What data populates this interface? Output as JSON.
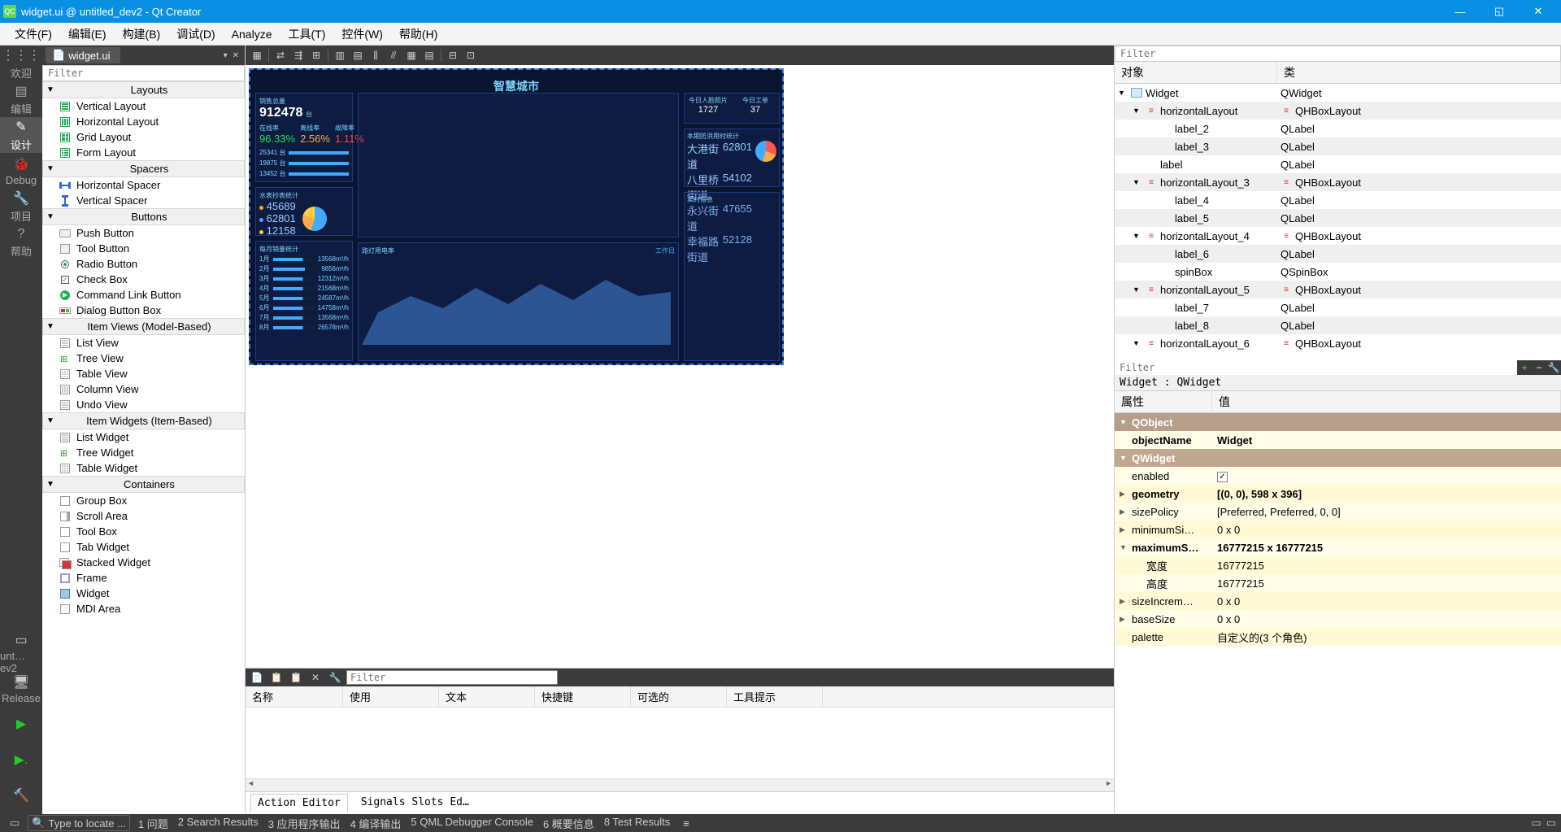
{
  "titlebar": {
    "icon_text": "QC",
    "text": "widget.ui @ untitled_dev2 - Qt Creator"
  },
  "menubar": [
    "文件(F)",
    "编辑(E)",
    "构建(B)",
    "调试(D)",
    "Analyze",
    "工具(T)",
    "控件(W)",
    "帮助(H)"
  ],
  "leftbar": [
    {
      "label": "欢迎",
      "icon": "⋮⋮⋮"
    },
    {
      "label": "编辑",
      "icon": "▤"
    },
    {
      "label": "设计",
      "icon": "✎",
      "active": true
    },
    {
      "label": "Debug",
      "icon": "🐞"
    },
    {
      "label": "项目",
      "icon": "🔧"
    },
    {
      "label": "帮助",
      "icon": "?"
    }
  ],
  "leftbar_bottom": [
    {
      "label": "unt…ev2",
      "icon": "▭"
    },
    {
      "label": "Release",
      "icon": "🖥"
    },
    {
      "label": "",
      "icon": "▶",
      "color": "#2c2"
    },
    {
      "label": "",
      "icon": "▶.",
      "color": "#2c2"
    },
    {
      "label": "",
      "icon": "🔨",
      "color": "#c84"
    }
  ],
  "tab_chip": {
    "icon": "📄",
    "label": "widget.ui"
  },
  "filter_placeholder": "Filter",
  "widgetbox": [
    {
      "cat": "Layouts",
      "items": [
        {
          "icon": "vlayout",
          "label": "Vertical Layout"
        },
        {
          "icon": "hlayout",
          "label": "Horizontal Layout"
        },
        {
          "icon": "grid",
          "label": "Grid Layout"
        },
        {
          "icon": "form",
          "label": "Form Layout"
        }
      ]
    },
    {
      "cat": "Spacers",
      "items": [
        {
          "icon": "hspacer",
          "label": "Horizontal Spacer"
        },
        {
          "icon": "vspacer",
          "label": "Vertical Spacer"
        }
      ]
    },
    {
      "cat": "Buttons",
      "items": [
        {
          "icon": "btn",
          "label": "Push Button"
        },
        {
          "icon": "tool",
          "label": "Tool Button"
        },
        {
          "icon": "radio",
          "label": "Radio Button"
        },
        {
          "icon": "check",
          "label": "Check Box"
        },
        {
          "icon": "cmdlink",
          "label": "Command Link Button"
        },
        {
          "icon": "dlgbox",
          "label": "Dialog Button Box"
        }
      ]
    },
    {
      "cat": "Item Views (Model-Based)",
      "items": [
        {
          "icon": "list",
          "label": "List View"
        },
        {
          "icon": "tree",
          "label": "Tree View"
        },
        {
          "icon": "table",
          "label": "Table View"
        },
        {
          "icon": "col",
          "label": "Column View"
        },
        {
          "icon": "list",
          "label": "Undo View"
        }
      ]
    },
    {
      "cat": "Item Widgets (Item-Based)",
      "items": [
        {
          "icon": "list",
          "label": "List Widget"
        },
        {
          "icon": "tree",
          "label": "Tree Widget"
        },
        {
          "icon": "table",
          "label": "Table Widget"
        }
      ]
    },
    {
      "cat": "Containers",
      "items": [
        {
          "icon": "box",
          "label": "Group Box"
        },
        {
          "icon": "scroll",
          "label": "Scroll Area"
        },
        {
          "icon": "box",
          "label": "Tool Box"
        },
        {
          "icon": "box",
          "label": "Tab Widget"
        },
        {
          "icon": "stack",
          "label": "Stacked Widget"
        },
        {
          "icon": "frame",
          "label": "Frame"
        },
        {
          "icon": "widget",
          "label": "Widget"
        },
        {
          "icon": "mdi",
          "label": "MDI Area"
        }
      ]
    }
  ],
  "dashboard": {
    "title": "智慧城市",
    "total_label": "销售总量",
    "total_value": "912478",
    "total_unit": "台",
    "rate1_label": "在线率",
    "rate1_value": "96.33%",
    "rate2_label": "离线率",
    "rate2_value": "2.56%",
    "rate3_label": "故障率",
    "rate3_value": "1.11%",
    "bars": [
      {
        "label": "25341",
        "unit": "台"
      },
      {
        "label": "19875",
        "unit": "台"
      },
      {
        "label": "13452",
        "unit": "台"
      }
    ],
    "pie_label": "水表抄表统计",
    "pie_items": [
      {
        "color": "#fa0",
        "val": "45689"
      },
      {
        "color": "#4af",
        "val": "62801"
      },
      {
        "color": "#fc4",
        "val": "12158"
      }
    ],
    "today1_label": "今日人脸照片",
    "today1_value": "1727",
    "today2_label": "今日工单",
    "today2_value": "37",
    "stats_label": "本期防洪用时统计",
    "stats": [
      {
        "k": "大港街道",
        "v": "62801"
      },
      {
        "k": "八里桥街道",
        "v": "54102"
      },
      {
        "k": "永兴街道",
        "v": "47655"
      },
      {
        "k": "幸福路街道",
        "v": "52128"
      }
    ],
    "realtime_label": "实时信息",
    "monthly_label": "每月销量统计",
    "monthly": [
      {
        "m": "1月",
        "v": "13568m³/h"
      },
      {
        "m": "2月",
        "v": "9856m³/h"
      },
      {
        "m": "3月",
        "v": "12312m³/h"
      },
      {
        "m": "4月",
        "v": "21568m³/h"
      },
      {
        "m": "5月",
        "v": "24587m³/h"
      },
      {
        "m": "6月",
        "v": "14758m³/h"
      },
      {
        "m": "7月",
        "v": "13568m³/h"
      },
      {
        "m": "8月",
        "v": "26578m³/h"
      }
    ],
    "line_label": "路灯用电率",
    "line_legend": "工作日"
  },
  "action_editor": {
    "filter_placeholder": "Filter",
    "columns": [
      "名称",
      "使用",
      "文本",
      "快捷键",
      "可选的",
      "工具提示"
    ],
    "tabs": [
      "Action Editor",
      "Signals  Slots Ed…"
    ]
  },
  "obj_tree": {
    "filter_placeholder": "Filter",
    "headers": [
      "对象",
      "类"
    ],
    "rows": [
      {
        "ind": 0,
        "arrow": "v",
        "icon": "widget",
        "name": "Widget",
        "cls": "QWidget"
      },
      {
        "ind": 1,
        "arrow": "v",
        "icon": "layout",
        "name": "horizontalLayout",
        "cls_icon": "layout",
        "cls": "QHBoxLayout",
        "alt": true
      },
      {
        "ind": 2,
        "name": "label_2",
        "cls": "QLabel"
      },
      {
        "ind": 2,
        "name": "label_3",
        "cls": "QLabel",
        "alt": true
      },
      {
        "ind": 1,
        "name": "label",
        "cls": "QLabel"
      },
      {
        "ind": 1,
        "arrow": "v",
        "icon": "layout",
        "name": "horizontalLayout_3",
        "cls_icon": "layout",
        "cls": "QHBoxLayout",
        "alt": true
      },
      {
        "ind": 2,
        "name": "label_4",
        "cls": "QLabel"
      },
      {
        "ind": 2,
        "name": "label_5",
        "cls": "QLabel",
        "alt": true
      },
      {
        "ind": 1,
        "arrow": "v",
        "icon": "layout",
        "name": "horizontalLayout_4",
        "cls_icon": "layout",
        "cls": "QHBoxLayout"
      },
      {
        "ind": 2,
        "name": "label_6",
        "cls": "QLabel",
        "alt": true
      },
      {
        "ind": 2,
        "name": "spinBox",
        "cls": "QSpinBox"
      },
      {
        "ind": 1,
        "arrow": "v",
        "icon": "layout",
        "name": "horizontalLayout_5",
        "cls_icon": "layout",
        "cls": "QHBoxLayout",
        "alt": true
      },
      {
        "ind": 2,
        "name": "label_7",
        "cls": "QLabel"
      },
      {
        "ind": 2,
        "name": "label_8",
        "cls": "QLabel",
        "alt": true
      },
      {
        "ind": 1,
        "arrow": "v",
        "icon": "layout",
        "name": "horizontalLayout_6",
        "cls_icon": "layout",
        "cls": "QHBoxLayout"
      }
    ]
  },
  "prop": {
    "filter_placeholder": "Filter",
    "crumb": "Widget : QWidget",
    "headers": [
      "属性",
      "值"
    ],
    "rows": [
      {
        "group": "QObject",
        "cls": "qobject"
      },
      {
        "k": "objectName",
        "v": "Widget",
        "bold": true,
        "yl": true
      },
      {
        "group": "QWidget",
        "cls": "qwidget"
      },
      {
        "k": "enabled",
        "v": "",
        "check": true,
        "yl": true
      },
      {
        "k": "geometry",
        "v": "[(0, 0), 598 x 396]",
        "bold": true,
        "arrow": ">",
        "yl": "yl2"
      },
      {
        "k": "sizePolicy",
        "v": "[Preferred, Preferred, 0, 0]",
        "arrow": ">",
        "yl": true
      },
      {
        "k": "minimumSi…",
        "v": "0 x 0",
        "arrow": ">",
        "yl": "yl2"
      },
      {
        "k": "maximumS…",
        "v": "16777215 x 16777215",
        "arrow": "v",
        "bold": true,
        "yl": true
      },
      {
        "k": "宽度",
        "v": "16777215",
        "ind": 1,
        "yl": "yl2"
      },
      {
        "k": "高度",
        "v": "16777215",
        "ind": 1,
        "yl": true
      },
      {
        "k": "sizeIncrem…",
        "v": "0 x 0",
        "arrow": ">",
        "yl": "yl2"
      },
      {
        "k": "baseSize",
        "v": "0 x 0",
        "arrow": ">",
        "yl": true
      },
      {
        "k": "palette",
        "v": "自定义的(3 个角色)",
        "yl": "yl2"
      }
    ]
  },
  "statusbar": {
    "locate_placeholder": "Type to locate ...",
    "items": [
      "1 问题",
      "2 Search Results",
      "3 应用程序输出",
      "4 编译输出",
      "5 QML Debugger Console",
      "6 概要信息",
      "8 Test Results"
    ]
  }
}
